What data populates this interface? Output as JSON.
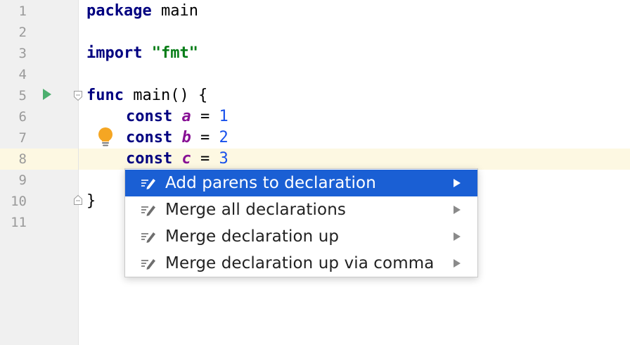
{
  "editor": {
    "line_numbers": [
      "1",
      "2",
      "3",
      "4",
      "5",
      "6",
      "7",
      "8",
      "9",
      "10",
      "11"
    ],
    "lines": {
      "l1_kw": "package",
      "l1_rest": " main",
      "l3_kw": "import",
      "l3_str": "\"fmt\"",
      "l5_kw": "func",
      "l5_rest": " main() {",
      "l6_kw": "const",
      "l6_name": "a",
      "l6_eq": " = ",
      "l6_val": "1",
      "l7_kw": "const",
      "l7_name": "b",
      "l7_eq": " = ",
      "l7_val": "2",
      "l8_kw": "const",
      "l8_name": "c",
      "l8_eq": " = ",
      "l8_val": "3",
      "l10_rest": "}"
    }
  },
  "intention_menu": {
    "items": [
      {
        "label": "Add parens to declaration",
        "icon": "edit-pencil-icon",
        "selected": true
      },
      {
        "label": "Merge all declarations",
        "icon": "edit-pencil-icon",
        "selected": false
      },
      {
        "label": "Merge declaration up",
        "icon": "edit-pencil-icon",
        "selected": false
      },
      {
        "label": "Merge declaration up via comma",
        "icon": "edit-pencil-icon",
        "selected": false
      }
    ]
  },
  "colors": {
    "selection": "#1a5fd4",
    "keyword": "#000080",
    "string": "#067d17",
    "number": "#1750eb",
    "constant": "#871094",
    "current_line": "#fdf8e2",
    "run_icon": "#4caf6e",
    "bulb": "#f5a623"
  }
}
